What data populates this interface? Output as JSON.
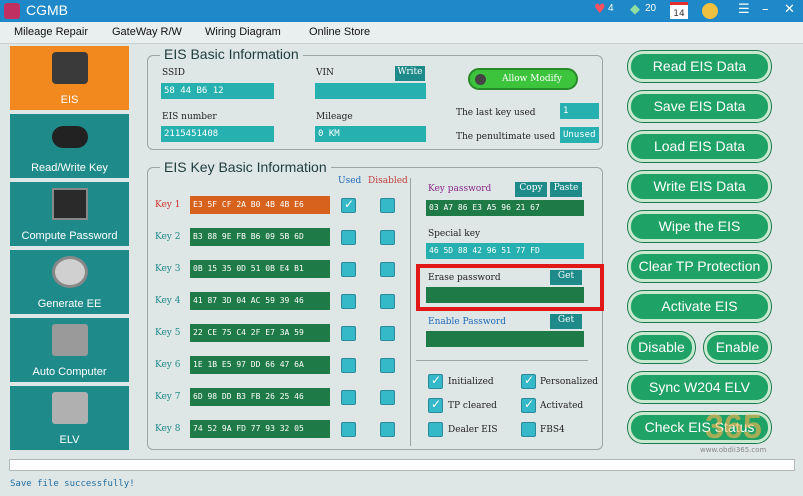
{
  "app": {
    "title": "CGMB"
  },
  "titlebar": {
    "hearts": "4",
    "gems": "20",
    "calendar": "14"
  },
  "menu": [
    "Mileage Repair",
    "GateWay R/W",
    "Wiring Diagram",
    "Online Store"
  ],
  "sidebar": [
    {
      "label": "EIS",
      "icon": "eis-module-icon",
      "active": true
    },
    {
      "label": "Read/Write Key",
      "icon": "car-key-icon"
    },
    {
      "label": "Compute Password",
      "icon": "laptop-icon"
    },
    {
      "label": "Generate EE",
      "icon": "printer-icon"
    },
    {
      "label": "Auto Computer",
      "icon": "ecu-icon"
    },
    {
      "label": "ELV",
      "icon": "elv-module-icon"
    }
  ],
  "eis_basic": {
    "title": "EIS Basic Information",
    "ssid_label": "SSID",
    "ssid_value": "58 44 B6 12",
    "vin_label": "VIN",
    "vin_value": "",
    "write_label": "Write",
    "allow_modify": "Allow Modify",
    "eis_number_label": "EIS number",
    "eis_number_value": "2115451408",
    "mileage_label": "Mileage",
    "mileage_value": "0 KM",
    "last_key_label": "The last key used",
    "last_key_value": "1",
    "penultimate_label": "The penultimate used",
    "penultimate_value": "Unused"
  },
  "eis_key": {
    "title": "EIS Key Basic Information",
    "used_header": "Used",
    "disabled_header": "Disabled",
    "keys": [
      {
        "label": "Key 1",
        "value": "E3 5F CF 2A B0 4B 4B E6",
        "used": true,
        "disabled": false,
        "selected": true
      },
      {
        "label": "Key 2",
        "value": "B3 88 9E FB B6 09 5B 6D",
        "used": false,
        "disabled": false
      },
      {
        "label": "Key 3",
        "value": "0B 15 35 0D 51 0B E4 B1",
        "used": false,
        "disabled": false
      },
      {
        "label": "Key 4",
        "value": "41 87 3D 04 AC 59 39 46",
        "used": false,
        "disabled": false
      },
      {
        "label": "Key 5",
        "value": "22 CE 75 C4 2F E7 3A 59",
        "used": false,
        "disabled": false
      },
      {
        "label": "Key 6",
        "value": "1E 1B E5 97 DD 66 47 6A",
        "used": false,
        "disabled": false
      },
      {
        "label": "Key 7",
        "value": "6D 98 DD B3 FB 26 25 46",
        "used": false,
        "disabled": false
      },
      {
        "label": "Key 8",
        "value": "74 52 9A FD 77 93 32 05",
        "used": false,
        "disabled": false
      }
    ],
    "key_password_label": "Key password",
    "copy_label": "Copy",
    "paste_label": "Paste",
    "key_password_value": "03 A7 86 E3 A5 96 21 67",
    "special_key_label": "Special key",
    "special_key_value": "46 5D 88 42 96 51 77 FD",
    "erase_password_label": "Erase password",
    "erase_get": "Get",
    "erase_value": "",
    "enable_password_label": "Enable Password",
    "enable_get": "Get",
    "enable_value": "",
    "flags": [
      {
        "label": "Initialized",
        "checked": true
      },
      {
        "label": "Personalized",
        "checked": true
      },
      {
        "label": "TP cleared",
        "checked": true
      },
      {
        "label": "Activated",
        "checked": true
      },
      {
        "label": "Dealer EIS",
        "checked": false
      },
      {
        "label": "FBS4",
        "checked": false
      }
    ]
  },
  "actions": {
    "read": "Read  EIS Data",
    "save": "Save EIS Data",
    "load": "Load EIS Data",
    "write": "Write EIS Data",
    "wipe": "Wipe the EIS",
    "clear_tp": "Clear TP Protection",
    "activate": "Activate EIS",
    "disable": "Disable",
    "enable": "Enable",
    "sync": "Sync W204 ELV",
    "check": "Check EIS Status"
  },
  "status": {
    "message": "Save file successfully!"
  },
  "watermark": {
    "text": "365",
    "url": "www.obdii365.com"
  },
  "colors": {
    "accent": "#1f8a8a",
    "active": "#f2891f",
    "green_button": "#1fa266",
    "highlight": "#e01818"
  }
}
